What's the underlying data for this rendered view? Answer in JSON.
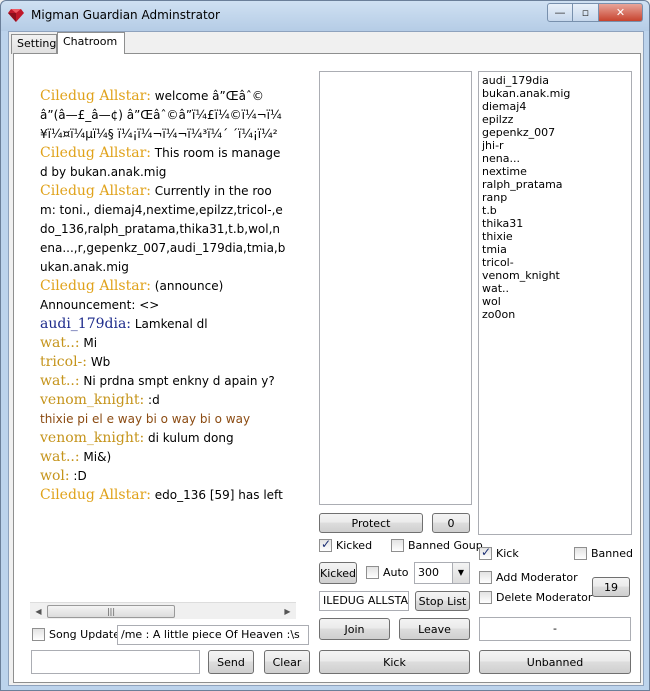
{
  "window": {
    "title": "Migman Guardian Adminstrator",
    "min_glyph": "—",
    "max_glyph": "▫",
    "close_glyph": "✕"
  },
  "tabs": [
    "Setting",
    "Chatroom"
  ],
  "chat": {
    "lines": [
      {
        "nick": "Ciledug Allstar:",
        "nick_color": "gold",
        "msg": " welcome â”Œâˆ©â”(â—£_â—¢) â”Œâˆ©â”ï¼£ï¼©ï¼¬ï¼¥ï¼¤ï¼µï¼§ ï¼¡ï¼¬ï¼¬ï¼³ï¼´ ´ï¼¡ï¼²",
        "wrap": true
      },
      {
        "nick": "Ciledug Allstar:",
        "nick_color": "gold",
        "msg": " This room is managed by bukan.anak.mig",
        "wrap": true
      },
      {
        "nick": "Ciledug Allstar:",
        "nick_color": "gold",
        "msg": " Currently in the room: toni., diemaj4,nextime,epilzz,tricol-,edo_136,ralph_pratama,thika31,t.b,wol,nena...,r,gepenkz_007,audi_179dia,tmia,bukan.anak.mig",
        "wrap": true
      },
      {
        "nick": "",
        "nick_color": "gold",
        "msg": " ",
        "wrap": false
      },
      {
        "nick": "Ciledug Allstar:",
        "nick_color": "gold",
        "msg": " (announce)",
        "wrap": false
      },
      {
        "nick": "",
        "nick_color": "gold",
        "msg": "Announcement: <>",
        "wrap": false
      },
      {
        "nick": "audi_179dia:",
        "nick_color": "navy",
        "msg": " Lamkenal dl",
        "wrap": false
      },
      {
        "nick": "wat..:",
        "nick_color": "olive",
        "msg": " Mi",
        "wrap": false
      },
      {
        "nick": "tricol-:",
        "nick_color": "olive",
        "msg": " Wb",
        "wrap": false
      },
      {
        "nick": "wat..:",
        "nick_color": "olive",
        "msg": " Ni prdna smpt enkny d apain y?",
        "wrap": false
      },
      {
        "nick": "venom_knight:",
        "nick_color": "olive",
        "msg": " :d",
        "wrap": false
      },
      {
        "nick": "",
        "nick_color": "olive",
        "msg": "thixie pi el e way bi o way bi o way",
        "msg_color": "brown",
        "wrap": false
      },
      {
        "nick": "venom_knight:",
        "nick_color": "olive",
        "msg": " di kulum dong",
        "wrap": false
      },
      {
        "nick": "wat..:",
        "nick_color": "olive",
        "msg": " Mi&)",
        "wrap": false
      },
      {
        "nick": "wol:",
        "nick_color": "olive",
        "msg": " :D",
        "wrap": false
      },
      {
        "nick": "Ciledug Allstar:",
        "nick_color": "gold",
        "msg": " edo_136 [59] has left",
        "wrap": false
      }
    ],
    "scroll_left": "◀",
    "scroll_right": "▶",
    "scroll_grip": "|||"
  },
  "song_updater": {
    "label": "Song Updater",
    "checked": false,
    "value": "/me : A little piece Of Heaven :\\s"
  },
  "message": {
    "value": "",
    "send_label": "Send",
    "clear_label": "Clear"
  },
  "middle": {
    "protect_label": "Protect",
    "protect_count": "0",
    "kicked_label": "Kicked",
    "kicked_checked": true,
    "banned_group_label": "Banned Goup",
    "banned_group_checked": false,
    "kicked_button_label": "Kicked",
    "auto_label": "Auto",
    "auto_checked": false,
    "interval_value": "300",
    "room_value": "ILEDUG ALLSTAR",
    "stop_list_label": "Stop List",
    "join_label": "Join",
    "leave_label": "Leave",
    "kick_label": "Kick"
  },
  "users": {
    "items": [
      "audi_179dia",
      "bukan.anak.mig",
      "diemaj4",
      "epilzz",
      "gepenkz_007",
      "jhi-r",
      "nena...",
      "nextime",
      "ralph_pratama",
      "ranp",
      "t.b",
      "thika31",
      "thixie",
      "tmia",
      "tricol-",
      "venom_knight",
      "wat..",
      "wol",
      "zo0on"
    ],
    "kick_label": "Kick",
    "kick_checked": true,
    "banned_label": "Banned",
    "banned_checked": false,
    "add_mod_label": "Add Moderator",
    "add_mod_checked": false,
    "del_mod_label": "Delete Moderator",
    "del_mod_checked": false,
    "count": "19",
    "status": "-",
    "unbanned_label": "Unbanned"
  },
  "colors": {
    "nick_gold": "#e0a21a",
    "nick_navy": "#1e2c8c",
    "nick_olive": "#c5941b",
    "msg_brown": "#8b4b12"
  }
}
